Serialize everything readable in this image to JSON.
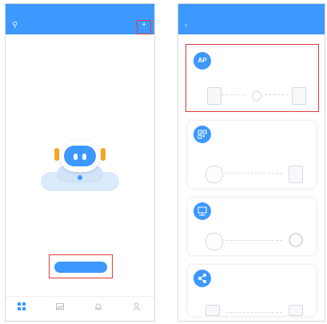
{
  "left_screen": {
    "status": {
      "time": "",
      "system": ""
    },
    "title": "",
    "empty_text": "",
    "add_device_label": "",
    "tabs": [
      {
        "label": "",
        "icon": "device-icon"
      },
      {
        "label": "",
        "icon": "image-icon"
      },
      {
        "label": "",
        "icon": "alarm-icon"
      },
      {
        "label": "",
        "icon": "user-icon"
      }
    ]
  },
  "right_screen": {
    "status": {
      "time": "",
      "system": ""
    },
    "title": "",
    "methods": [
      {
        "badge": "AP",
        "title": "",
        "desc": "",
        "icon": "ap-badge-icon"
      },
      {
        "badge": "",
        "title": "",
        "desc": "",
        "icon": "qr-icon"
      },
      {
        "badge": "",
        "title": "",
        "desc": "",
        "icon": "lan-icon"
      },
      {
        "badge": "",
        "title": "",
        "desc": "",
        "icon": "share-icon"
      }
    ]
  },
  "colors": {
    "accent": "#3d98ff",
    "highlight": "#e23b3b"
  }
}
